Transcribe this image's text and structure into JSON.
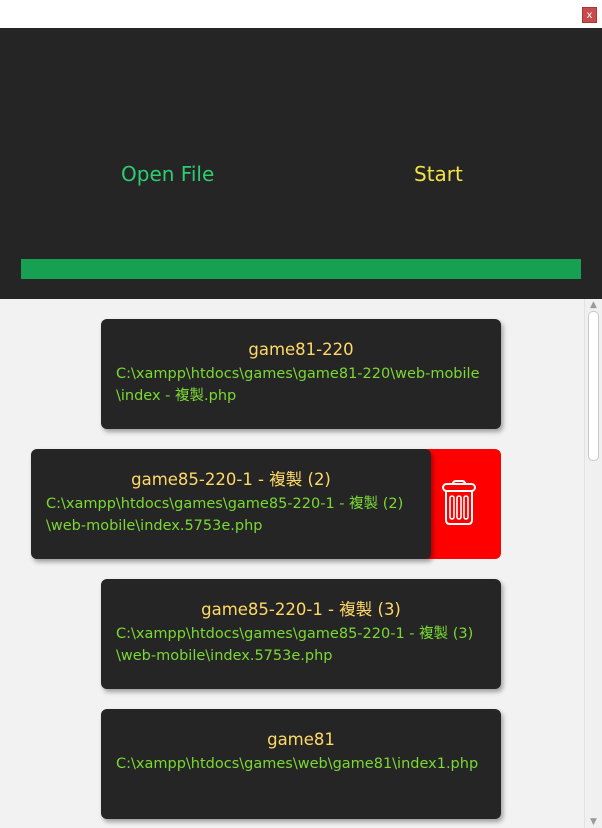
{
  "window": {
    "close_label": "x"
  },
  "toolbar": {
    "open_label": "Open File",
    "start_label": "Start",
    "progress_percent": 100
  },
  "colors": {
    "panel_bg": "#252525",
    "open_text": "#2ecc71",
    "start_text": "#f2e24a",
    "progress_fill": "#17a052",
    "card_bg": "#252525",
    "card_title": "#ffd966",
    "card_path": "#7ad934",
    "delete_bg": "#ff0000"
  },
  "icons": {
    "delete": "trash-icon"
  },
  "files": [
    {
      "name": "game81-220",
      "path": "C:\\xampp\\htdocs\\games\\game81-220\\web-mobile\\index - 複製.php"
    },
    {
      "name": "game85-220-1 - 複製 (2)",
      "path": "C:\\xampp\\htdocs\\games\\game85-220-1 - 複製 (2)\\web-mobile\\index.5753e.php"
    },
    {
      "name": "game85-220-1 - 複製 (3)",
      "path": "C:\\xampp\\htdocs\\games\\game85-220-1 - 複製 (3)\\web-mobile\\index.5753e.php"
    },
    {
      "name": "game81",
      "path": "C:\\xampp\\htdocs\\games\\web\\game81\\index1.php"
    }
  ]
}
